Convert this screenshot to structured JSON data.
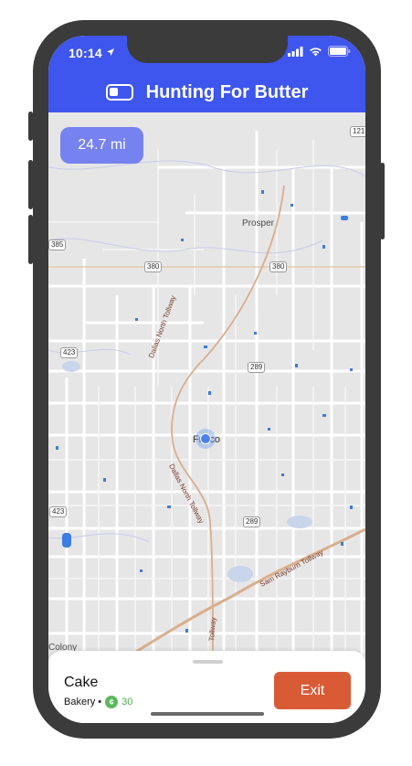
{
  "status_bar": {
    "time": "10:14"
  },
  "header": {
    "title": "Hunting For Butter",
    "toggle_icon": "toggle-icon"
  },
  "map": {
    "distance": "24.7 mi",
    "labels": {
      "prosper": "Prosper",
      "frisco": "Frisco",
      "colony": "Colony",
      "dnt_north": "Dallas North Tollway",
      "dnt_south": "Dallas North Tollway",
      "dnt_bottom": "Tollway",
      "sam_rayburn": "Sam Rayburn Tollway",
      "r380a": "380",
      "r380b": "380",
      "r289a": "289",
      "r289b": "289",
      "r423a": "423",
      "r423b": "423",
      "r121": "121",
      "r385": "385"
    }
  },
  "place": {
    "name": "Cake",
    "category": "Bakery •",
    "coin_symbol": "¢",
    "points": "30"
  },
  "actions": {
    "exit_label": "Exit"
  },
  "colors": {
    "header": "#3e56ee",
    "exit": "#d95b36",
    "points": "#4cae4c"
  }
}
